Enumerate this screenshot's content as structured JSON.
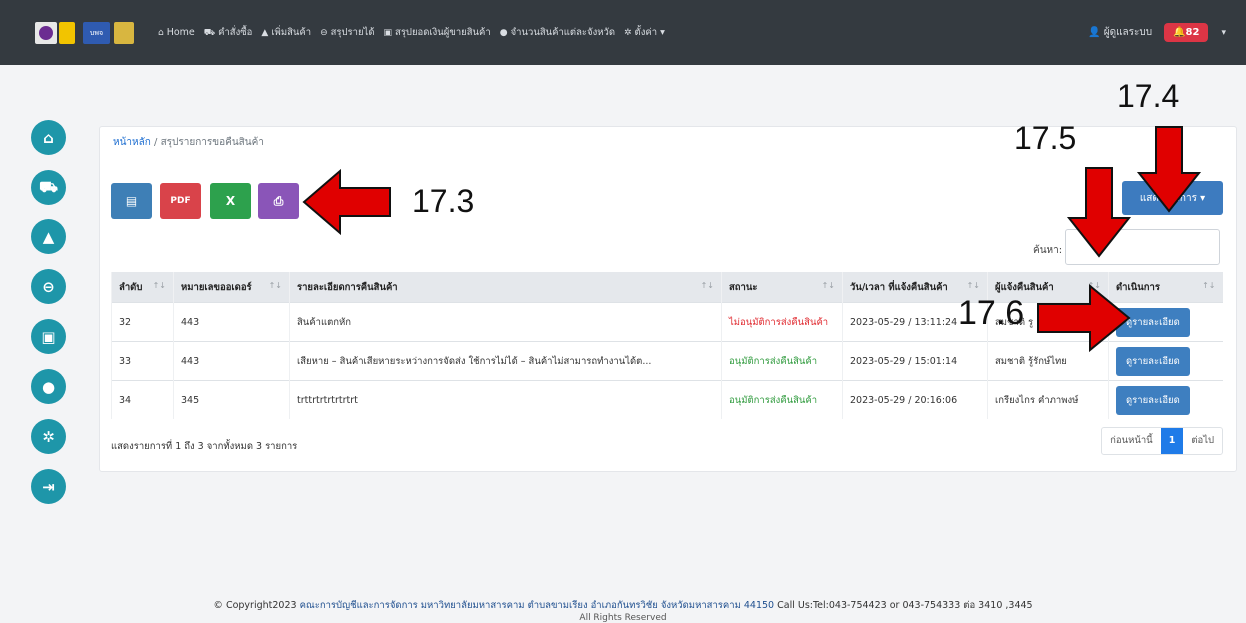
{
  "navbar": {
    "logo_text": "บพจ",
    "links": [
      {
        "icon": "home-icon",
        "glyph": "⌂",
        "label": "Home"
      },
      {
        "icon": "cart-icon",
        "glyph": "⛟",
        "label": "คำสั่งซื้อ"
      },
      {
        "icon": "bag-icon",
        "glyph": "▲",
        "label": "เพิ่มสินค้า"
      },
      {
        "icon": "tag-icon",
        "glyph": "⊖",
        "label": "สรุปรายได้"
      },
      {
        "icon": "cash-icon",
        "glyph": "▣",
        "label": "สรุปยอดเงินผู้ขายสินค้า"
      },
      {
        "icon": "pin-icon",
        "glyph": "●",
        "label": "จำนวนสินค้าแต่ละจังหวัด"
      },
      {
        "icon": "gear-icon",
        "glyph": "✲",
        "label": "ตั้งค่า ▾"
      }
    ],
    "user_label": "ผู้ดูแลระบบ",
    "notification_count": "82"
  },
  "breadcrumb": {
    "home": "หน้าหลัก",
    "current": "สรุปรายการขอคืนสินค้า"
  },
  "toolbar": {
    "pdf_label": "PDF",
    "columns_label": "แสดง...มการ ▾"
  },
  "search": {
    "label": "ค้นหา:",
    "value": ""
  },
  "table": {
    "headers": [
      "ลำดับ",
      "หมายเลขออเดอร์",
      "รายละเอียดการคืนสินค้า",
      "สถานะ",
      "วัน/เวลา ที่แจ้งคืนสินค้า",
      "ผู้แจ้งคืนสินค้า",
      "ดำเนินการ"
    ],
    "rows": [
      {
        "no": "32",
        "order": "443",
        "detail": "สินค้าแตกหัก",
        "status": "ไม่อนุมัติการส่งคืนสินค้า",
        "datetime": "2023-05-29 / 13:11:24",
        "reporter": "สมชาติ รู",
        "action": "ดูรายละเอียด"
      },
      {
        "no": "33",
        "order": "443",
        "detail": "เสียหาย – สินค้าเสียหายระหว่างการจัดส่ง ใช้การไม่ได้ – สินค้าไม่สามารถทำงานได้ต...",
        "status": "อนุมัติการส่งคืนสินค้า",
        "datetime": "2023-05-29 / 15:01:14",
        "reporter": "สมชาติ รู้รักษ์ไทย",
        "action": "ดูรายละเอียด"
      },
      {
        "no": "34",
        "order": "345",
        "detail": "trttrtrtrtrtrtrt",
        "status": "อนุมัติการส่งคืนสินค้า",
        "datetime": "2023-05-29 / 20:16:06",
        "reporter": "เกรียงไกร คำภาพงษ์",
        "action": "ดูรายละเอียด"
      }
    ]
  },
  "summary": "แสดงรายการที่ 1 ถึง 3 จากทั้งหมด 3 รายการ",
  "pagination": {
    "prev": "ก่อนหน้านี้",
    "current": "1",
    "next": "ต่อไป"
  },
  "annotations": {
    "a173": "17.3",
    "a174": "17.4",
    "a175": "17.5",
    "a176": "17.6"
  },
  "footer": {
    "prefix": "© Copyright2023 ",
    "org": "คณะการบัญชีและการจัดการ มหาวิทยาลัยมหาสารคาม ตำบลขามเรียง อำเภอกันทรวิชัย จังหวัดมหาสารคาม 44150",
    "contact": " Call Us:Tel:043-754423 or 043-754333 ต่อ 3410 ,3445",
    "rights": "All Rights Reserved"
  },
  "colors": {
    "navbar": "#343a40",
    "sidebar": "#1e96a9",
    "primary": "#3e7fc0",
    "annotation_arrow": "#e00000"
  }
}
